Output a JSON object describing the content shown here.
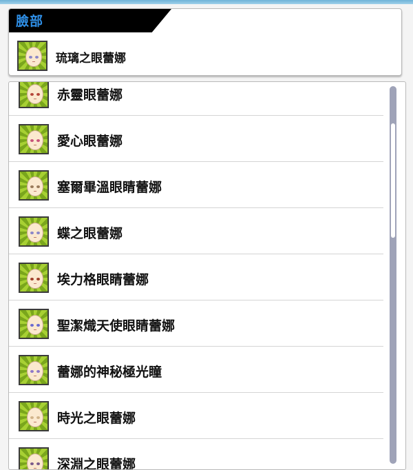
{
  "header": {
    "title": "臉部",
    "selected_item": "琉璃之眼蕾娜"
  },
  "list": {
    "items": [
      {
        "label": "赤靈眼蕾娜",
        "eye_color": "#b5463a"
      },
      {
        "label": "愛心眼蕾娜",
        "eye_color": "#c7547a"
      },
      {
        "label": "塞爾畢溫眼睛蕾娜",
        "eye_color": "#9a7a5a"
      },
      {
        "label": "蝶之眼蕾娜",
        "eye_color": "#8a86c8"
      },
      {
        "label": "埃力格眼睛蕾娜",
        "eye_color": "#a0402a"
      },
      {
        "label": "聖潔熾天使眼睛蕾娜",
        "eye_color": "#6a6ad0"
      },
      {
        "label": "蕾娜的神秘極光瞳",
        "eye_color": "#8f78c8"
      },
      {
        "label": "時光之眼蕾娜",
        "eye_color": "#d2b48a"
      },
      {
        "label": "深淵之眼蕾娜",
        "eye_color": "#7a5a8a"
      }
    ]
  },
  "colors": {
    "header_title": "#2f8fe6",
    "thumb_light": "#a7d033",
    "thumb_dark": "#7aa61c",
    "scrollbar": "#9fa3b8"
  }
}
